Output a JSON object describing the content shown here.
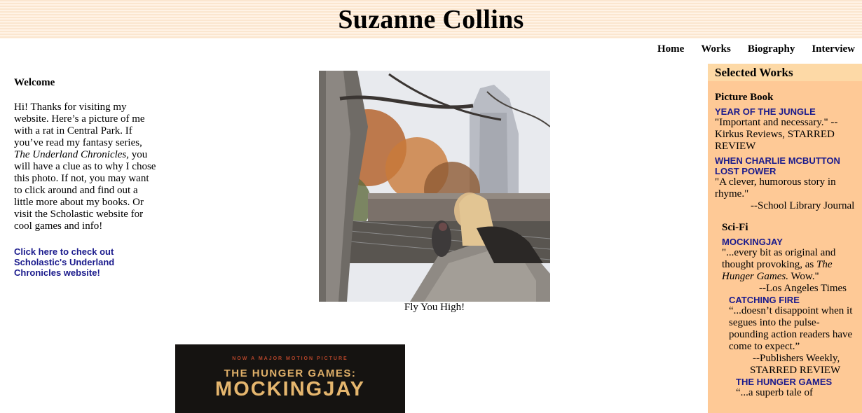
{
  "header": {
    "title": "Suzanne Collins"
  },
  "nav": {
    "items": [
      "Home",
      "Works",
      "Biography",
      "Interview"
    ]
  },
  "welcome": {
    "heading": "Welcome",
    "text_part1": "Hi! Thanks for visiting my website. Here’s a picture of me with a rat in Central Park. If you’ve read my fantasy series, ",
    "text_italic": "The Underland Chronicles,",
    "text_part2": " you will have a clue as to why I chose this photo. If not, you may want to click around and find out a little more about my books. Or visit the Scholastic website for cool games and info!",
    "link": "Click here to check out Scholastic's Underland Chronicles website!"
  },
  "photo": {
    "caption": "Fly You High!"
  },
  "book": {
    "small_text": "NOW A MAJOR MOTION PICTURE",
    "series": "THE HUNGER GAMES:",
    "title": "MOCKINGJAY"
  },
  "sidebar": {
    "title": "Selected Works",
    "picture_book": {
      "category": "Picture Book",
      "items": [
        {
          "title": "YEAR OF THE JUNGLE",
          "quote": "\"Important and necessary.\" --Kirkus Reviews, STARRED REVIEW"
        },
        {
          "title": "WHEN CHARLIE MCBUTTON LOST POWER",
          "quote": "\"A clever, humorous story in rhyme.\"",
          "attribution": "--School Library Journal"
        }
      ]
    },
    "scifi": {
      "category": "Sci-Fi",
      "mockingjay": {
        "title": "MOCKINGJAY",
        "quote_part1": "\"...every bit as original and thought provoking, as ",
        "quote_italic": "The Hunger Games.",
        "quote_part2": " Wow.\"",
        "attribution": "--Los Angeles Times"
      },
      "catching_fire": {
        "title": "CATCHING FIRE",
        "quote": "“...doesn’t disappoint when it segues into the pulse-pounding action readers have come to expect.”",
        "attribution1": "--Publishers Weekly,",
        "attribution2": "STARRED REVIEW"
      },
      "hunger_games": {
        "title": "THE HUNGER GAMES",
        "quote": "“...a superb tale of"
      }
    }
  }
}
